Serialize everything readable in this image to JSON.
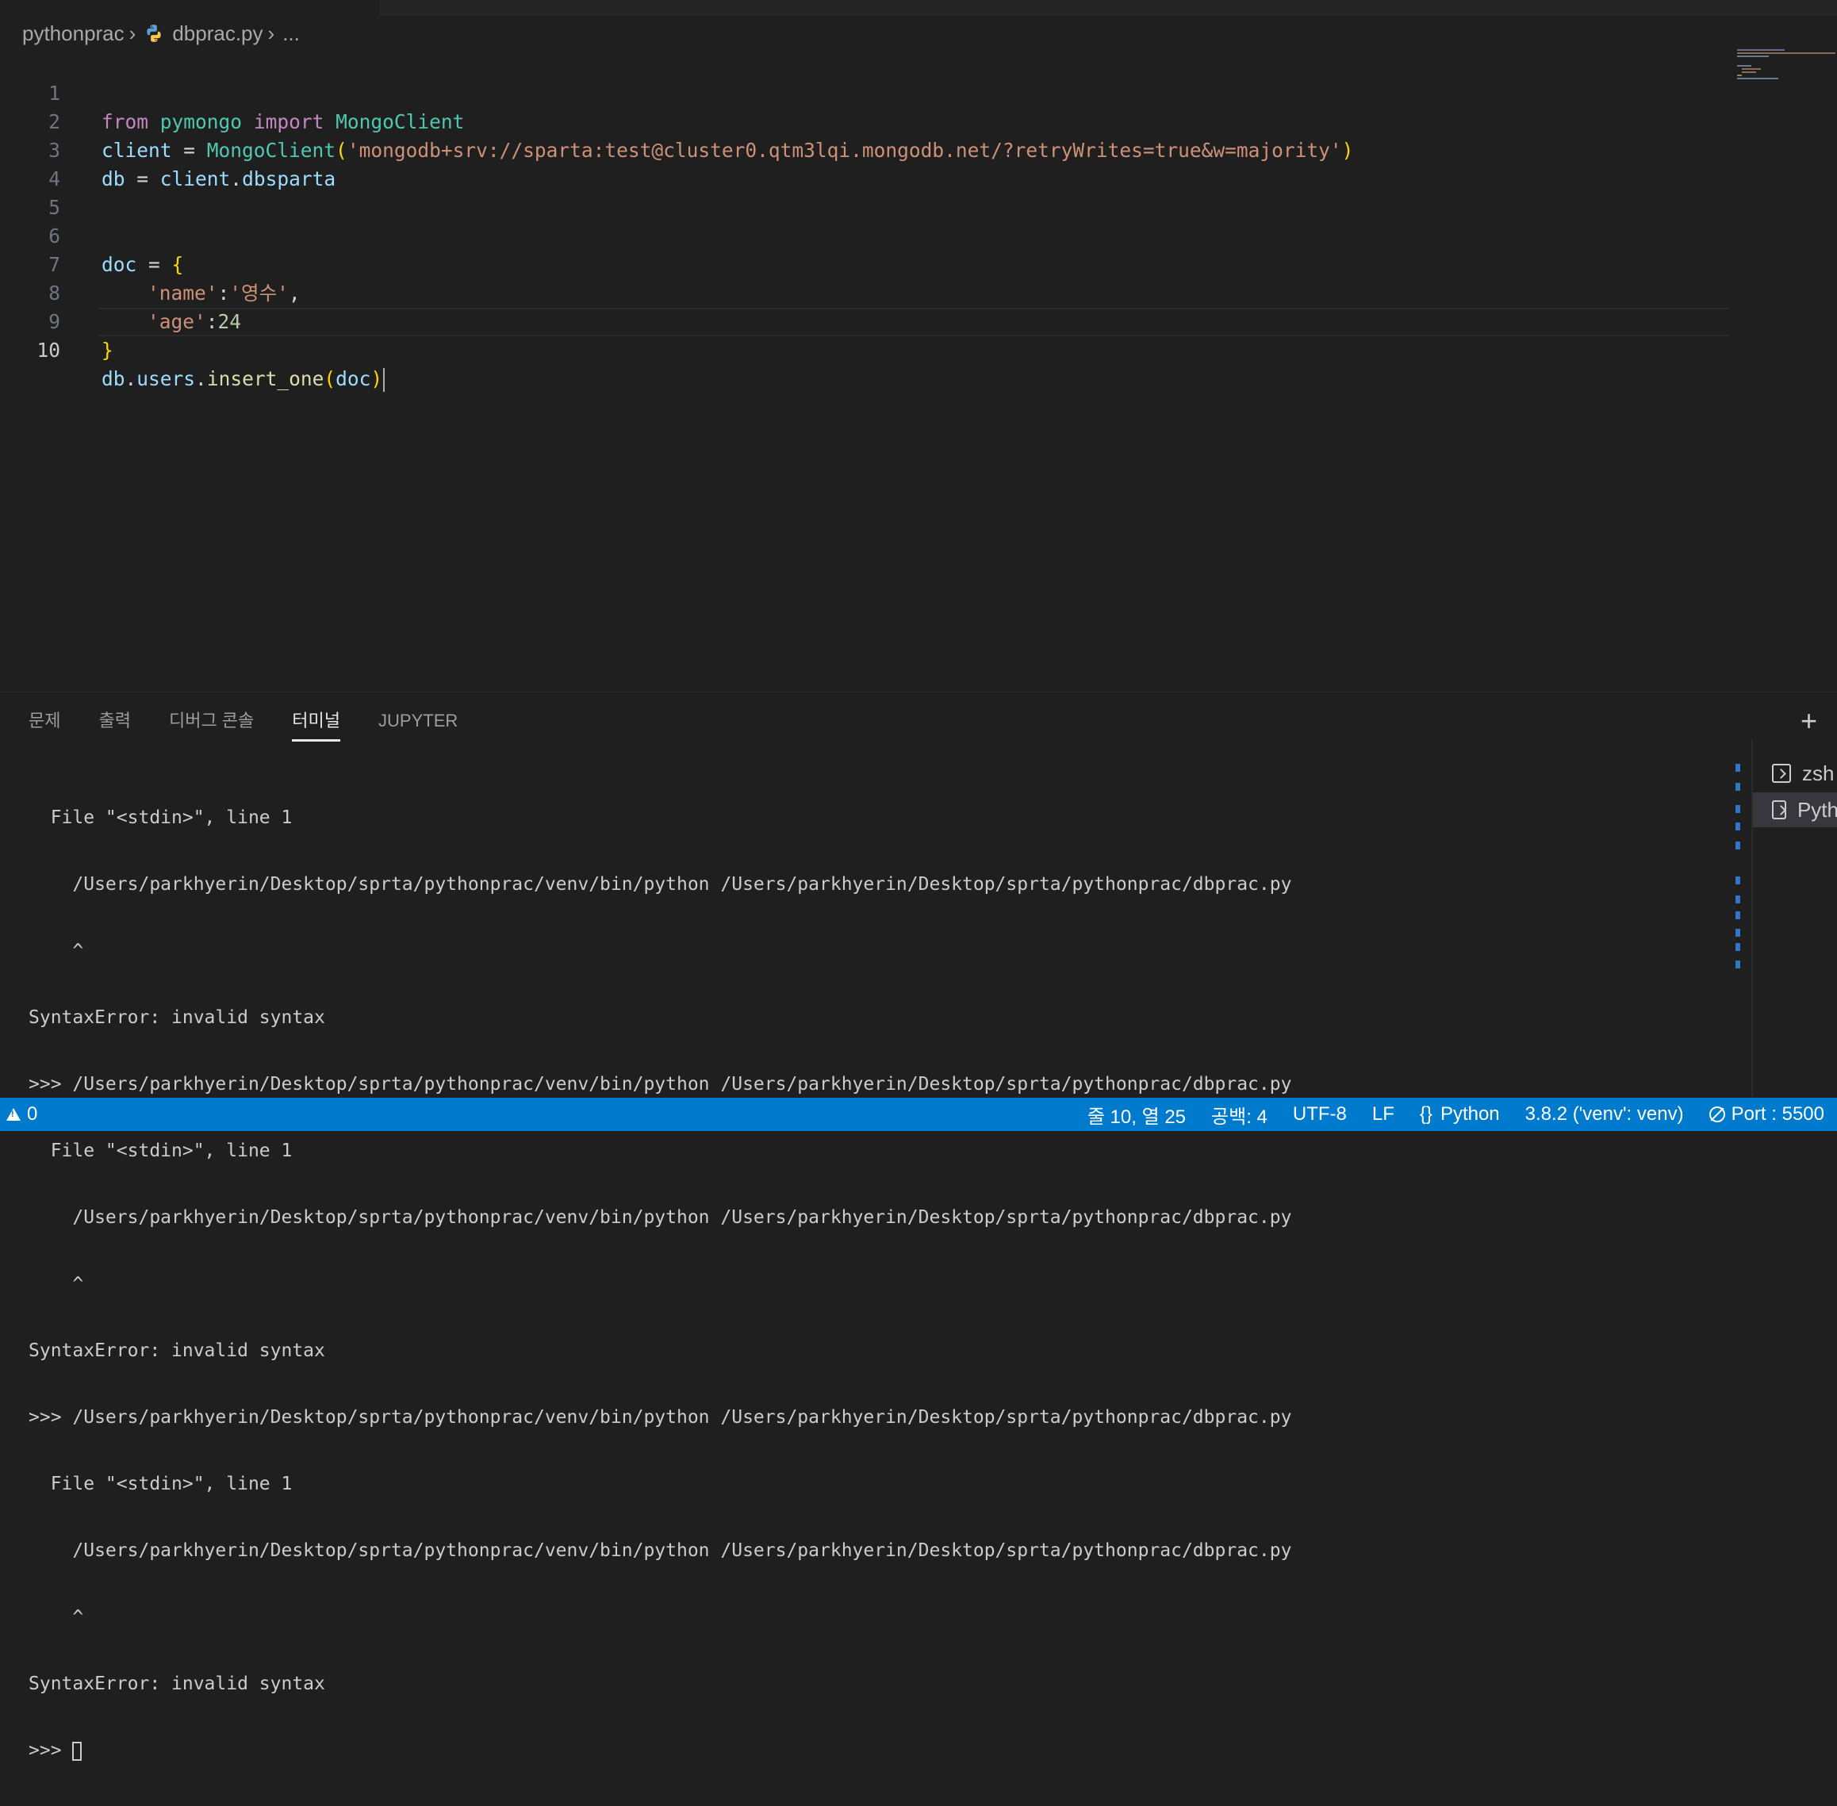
{
  "breadcrumb": {
    "folder": "pythonprac",
    "file": "dbprac.py",
    "more": "..."
  },
  "editor": {
    "line_numbers": [
      "1",
      "2",
      "3",
      "4",
      "5",
      "6",
      "7",
      "8",
      "9",
      "10"
    ],
    "current_line": "10",
    "lines": {
      "l1": {
        "kw_from": "from",
        "mod": "pymongo",
        "kw_import": "import",
        "cls": "MongoClient"
      },
      "l2": {
        "var": "client",
        "eq": " = ",
        "cls": "MongoClient",
        "open": "(",
        "str": "'mongodb+srv://sparta:test@cluster0.qtm3lqi.mongodb.net/?retryWrites=true&w=majority'",
        "close": ")"
      },
      "l3": {
        "var1": "db",
        "eq": " = ",
        "var2": "client",
        "dot": ".",
        "attr": "dbsparta"
      },
      "l6": {
        "var": "doc",
        "eq": " = ",
        "open": "{"
      },
      "l7": {
        "key": "'name'",
        "colon": ":",
        "val": "'영수'",
        "comma": ","
      },
      "l8": {
        "key": "'age'",
        "colon": ":",
        "val": "24"
      },
      "l9": {
        "close": "}"
      },
      "l10": {
        "var1": "db",
        "dot1": ".",
        "var2": "users",
        "dot2": ".",
        "fn": "insert_one",
        "open": "(",
        "arg": "doc",
        "close": ")"
      }
    }
  },
  "panel": {
    "tabs": [
      "문제",
      "출력",
      "디버그 콘솔",
      "터미널",
      "JUPYTER"
    ],
    "active_tab": "터미널"
  },
  "terminal": {
    "lines": [
      "  File \"<stdin>\", line 1",
      "    /Users/parkhyerin/Desktop/sprta/pythonprac/venv/bin/python /Users/parkhyerin/Desktop/sprta/pythonprac/dbprac.py",
      "    ^",
      "SyntaxError: invalid syntax",
      ">>> /Users/parkhyerin/Desktop/sprta/pythonprac/venv/bin/python /Users/parkhyerin/Desktop/sprta/pythonprac/dbprac.py",
      "  File \"<stdin>\", line 1",
      "    /Users/parkhyerin/Desktop/sprta/pythonprac/venv/bin/python /Users/parkhyerin/Desktop/sprta/pythonprac/dbprac.py",
      "    ^",
      "SyntaxError: invalid syntax",
      ">>> /Users/parkhyerin/Desktop/sprta/pythonprac/venv/bin/python /Users/parkhyerin/Desktop/sprta/pythonprac/dbprac.py",
      "  File \"<stdin>\", line 1",
      "    /Users/parkhyerin/Desktop/sprta/pythonprac/venv/bin/python /Users/parkhyerin/Desktop/sprta/pythonprac/dbprac.py",
      "    ^",
      "SyntaxError: invalid syntax"
    ],
    "prompt": ">>> ",
    "instances": [
      "zsh",
      "Pyth"
    ]
  },
  "statusbar": {
    "warnings": "0",
    "position": "줄 10, 열 25",
    "indent": "공백: 4",
    "encoding": "UTF-8",
    "eol": "LF",
    "language": "Python",
    "interpreter": "3.8.2 ('venv': venv)",
    "port": "Port : 5500"
  },
  "colors": {
    "statusbar_bg": "#007acc",
    "editor_bg": "#1f1f1f",
    "string": "#ce9178",
    "keyword": "#c586c0",
    "class": "#4ec9b0",
    "variable": "#9cdcfe",
    "function": "#dcdcaa"
  },
  "icons": [
    "python-file-icon",
    "chevron-right-icon",
    "plus-icon",
    "terminal-icon",
    "warning-icon",
    "braces-icon",
    "no-sign-icon"
  ]
}
